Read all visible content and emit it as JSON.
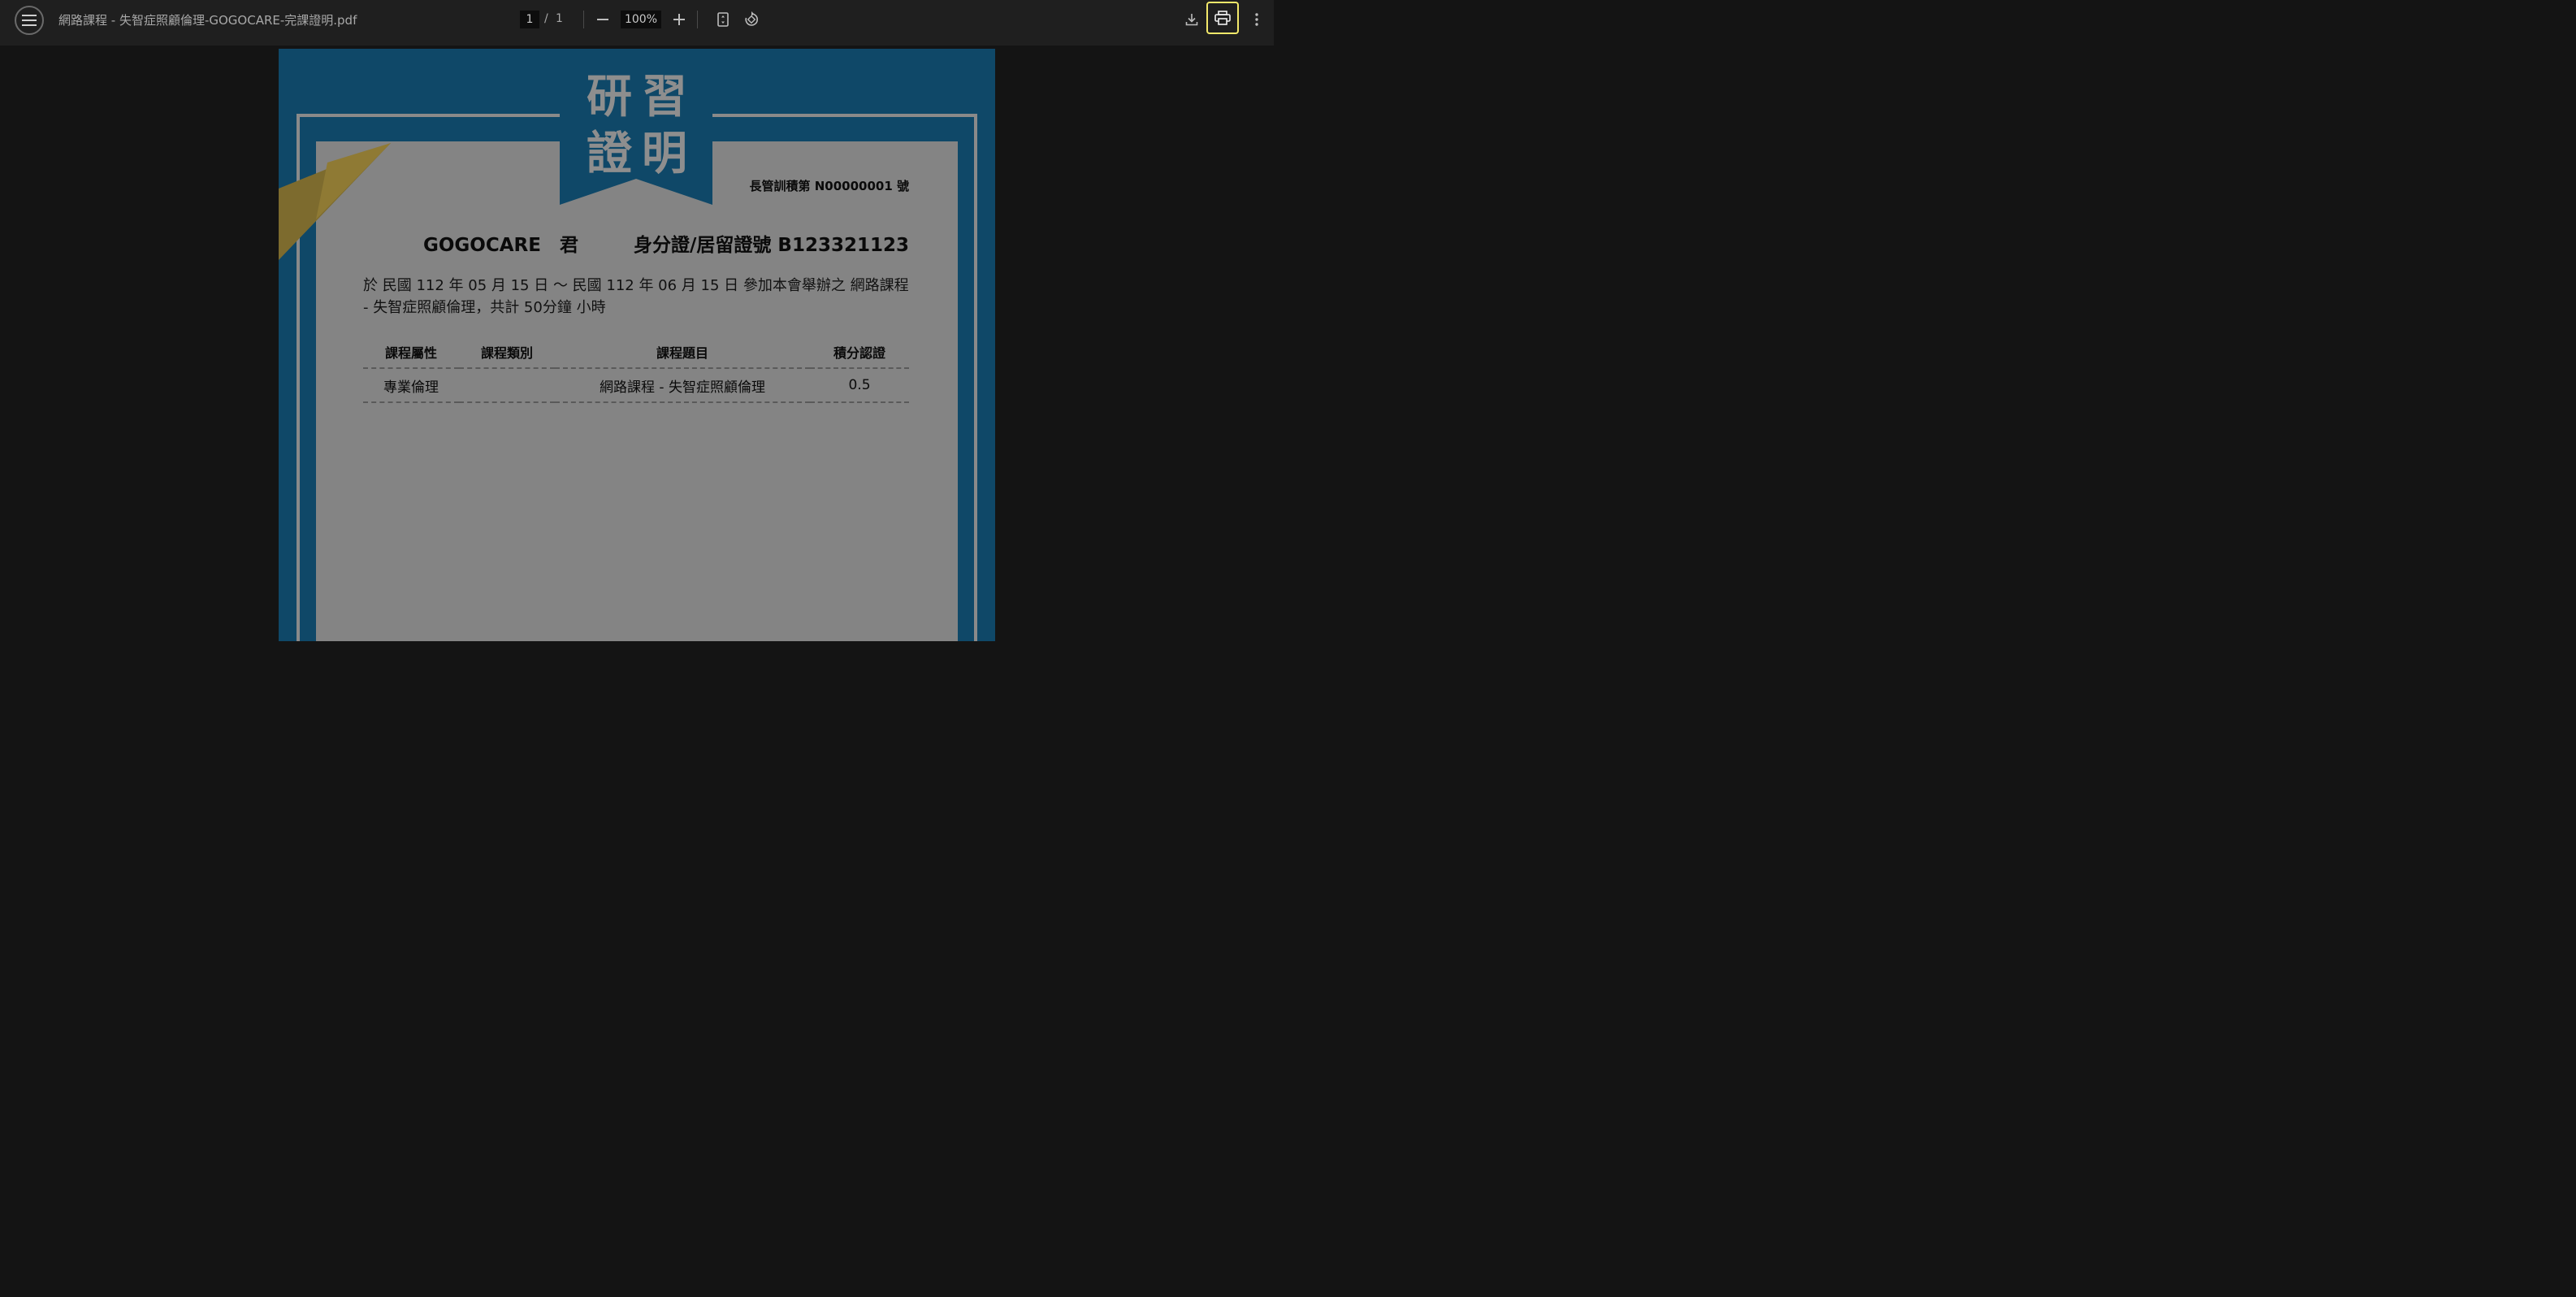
{
  "toolbar": {
    "menu_icon": "hamburger-menu-icon",
    "title": "網路課程 - 失智症照顧倫理-GOGOCARE-完課證明.pdf",
    "page_current": "1",
    "page_separator": "/",
    "page_total": "1",
    "zoom": "100%",
    "icons": [
      "zoom-out-icon",
      "zoom-in-icon",
      "fit-page-icon",
      "rotate-icon",
      "download-icon",
      "print-icon",
      "more-vert-icon"
    ],
    "print_highlight_color": "#f2e86a"
  },
  "certificate": {
    "seal_top": "研習",
    "seal_bottom": "證明",
    "cert_no": "長管訓積第 N00000001 號",
    "name": "GOGOCARE　君",
    "id_line": "身分證/居留證號 B123321123",
    "description": "於 民國 112 年 05 月 15 日 ～ 民國 112 年 06 月 15 日 參加本會舉辦之 網路課程 - 失智症照顧倫理，共計 50分鐘 小時",
    "table": {
      "headers": [
        "課程屬性",
        "課程類別",
        "課程題目",
        "積分認證"
      ],
      "rows": [
        [
          "專業倫理",
          "",
          "網路課程 - 失智症照顧倫理",
          "0.5"
        ]
      ]
    },
    "colors": {
      "frame_blue": "#0f4868",
      "gold": "#7d6b2e",
      "paper": "#848484"
    }
  }
}
